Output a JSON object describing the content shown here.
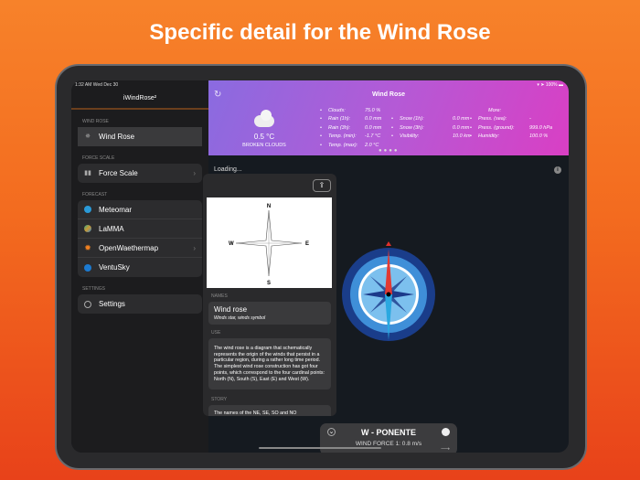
{
  "headline": "Specific detail for the Wind Rose",
  "status": {
    "time": "1:32 AM  Wed Dec 30",
    "battery": "100%"
  },
  "sidebar": {
    "title": "iWindRose²",
    "sections": [
      {
        "label": "WIND ROSE",
        "items": [
          {
            "label": "Wind Rose",
            "icon": "compass-icon"
          }
        ]
      },
      {
        "label": "FORCE SCALE",
        "items": [
          {
            "label": "Force Scale",
            "icon": "book-icon"
          }
        ]
      },
      {
        "label": "FORECAST",
        "items": [
          {
            "label": "Meteomar",
            "icon": "meteomar-icon"
          },
          {
            "label": "LaMMA",
            "icon": "lamma-icon"
          },
          {
            "label": "OpenWaethermap",
            "icon": "sun-icon"
          },
          {
            "label": "VentuSky",
            "icon": "ventusky-icon"
          }
        ]
      },
      {
        "label": "SETTINGS",
        "items": [
          {
            "label": "Settings",
            "icon": "gear-icon"
          }
        ]
      }
    ]
  },
  "header": {
    "title": "Wind Rose",
    "temp": "0.5 °C",
    "condition": "BROKEN CLOUDS",
    "more": "More:",
    "col1": [
      [
        "Clouds:",
        "75.0 %"
      ],
      [
        "Rain (1h):",
        "0.0 mm"
      ],
      [
        "Rain (3h):",
        "0.0 mm"
      ],
      [
        "Temp. (min):",
        "-1.7 °C"
      ],
      [
        "Temp. (max):",
        "2.0 °C"
      ]
    ],
    "col2": [
      [
        "Snow (1h):",
        "0.0 mm"
      ],
      [
        "Snow (3h):",
        "0.0 mm"
      ],
      [
        "Visibility:",
        "10.0 km"
      ]
    ],
    "col3": [
      [
        "Press. (sea):",
        "-"
      ],
      [
        "Press. (ground):",
        "999.0 hPa"
      ],
      [
        "Humidity:",
        "100.0 %"
      ]
    ]
  },
  "main": {
    "loading": "Loading..."
  },
  "popover": {
    "compass_labels": {
      "n": "N",
      "s": "S",
      "e": "E",
      "w": "W"
    },
    "names_label": "NAMES",
    "name": "Wind rose",
    "aliases": "Winds star, winds symbol",
    "use_label": "USE",
    "use_text": "The wind rose is a diagram that schematically represents the origin of the winds that persist in a particular region, during a rather long time period. The simplest wind rose construction has got four points, which correspond to the four cardinal points: North (N), South (S), East (E) and West (W).",
    "story_label": "STORY",
    "story_text": "The names of the NE, SE, SO and NO"
  },
  "bottom": {
    "direction": "W - PONENTE",
    "force": "WIND FORCE 1: 0.8 m/s"
  }
}
